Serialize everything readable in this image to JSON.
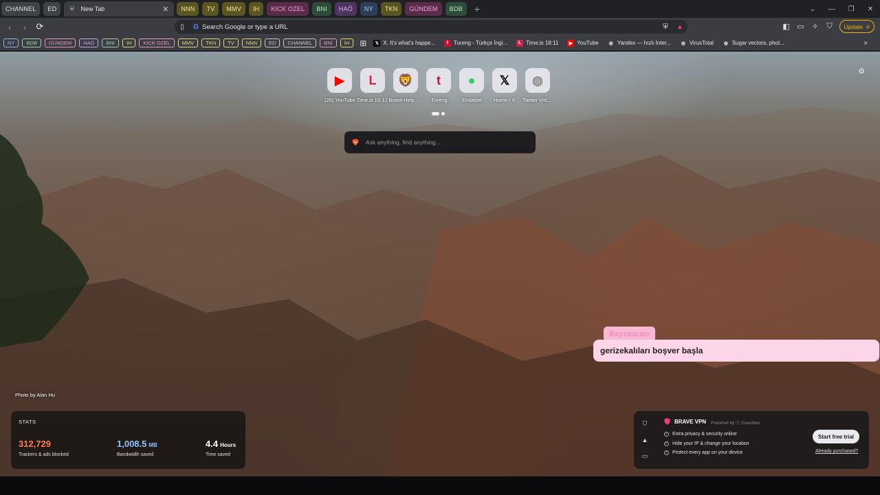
{
  "tab_groups_left": [
    {
      "label": "CHANNEL",
      "bg": "#3f4246",
      "fg": "#e4e4e4"
    },
    {
      "label": "ED",
      "bg": "#3f4246",
      "fg": "#e4e4e4"
    }
  ],
  "active_tab": {
    "title": "New Tab"
  },
  "tab_groups_right": [
    {
      "label": "NNN",
      "bg": "#5b5521",
      "fg": "#f5e9a3"
    },
    {
      "label": "TV",
      "bg": "#5b5521",
      "fg": "#f5e9a3"
    },
    {
      "label": "MMV",
      "bg": "#5b5521",
      "fg": "#f5e9a3"
    },
    {
      "label": "IH",
      "bg": "#5b5521",
      "fg": "#f5e9a3"
    },
    {
      "label": "KICK OZEL",
      "bg": "#5d2b4a",
      "fg": "#f1a6d6"
    },
    {
      "label": "BNI",
      "bg": "#2f4b3a",
      "fg": "#bfe7c9"
    },
    {
      "label": "HAÖ",
      "bg": "#4d3462",
      "fg": "#dcbcf6"
    },
    {
      "label": "NY",
      "bg": "#2b3e5a",
      "fg": "#b9d2f7"
    },
    {
      "label": "TKN",
      "bg": "#5b5521",
      "fg": "#f5e9a3"
    },
    {
      "label": "GÜNDEM",
      "bg": "#5d2b4a",
      "fg": "#f1a6d6"
    },
    {
      "label": "BDB",
      "bg": "#2f4b3a",
      "fg": "#bfe7c9"
    }
  ],
  "window_controls": {
    "list": "⌄",
    "minimize": "—",
    "restore": "❐",
    "close": "✕"
  },
  "toolbar": {
    "url_placeholder": "Search Google or type a URL",
    "update_label": "Update"
  },
  "bookmark_folders": [
    {
      "label": "NY",
      "color": "#8fb3ea"
    },
    {
      "label": "BDB",
      "color": "#9fd3a8"
    },
    {
      "label": "GÜNDEM",
      "color": "#e79ac8"
    },
    {
      "label": "HAÖ",
      "color": "#c8a4ee"
    },
    {
      "label": "BNI",
      "color": "#9fd3a8"
    },
    {
      "label": "IH",
      "color": "#e6d77a"
    },
    {
      "label": "KICK OZEL",
      "color": "#e79ac8"
    },
    {
      "label": "MMV",
      "color": "#e6d77a"
    },
    {
      "label": "TKN",
      "color": "#e6d77a"
    },
    {
      "label": "TV",
      "color": "#e6d77a"
    },
    {
      "label": "NNN",
      "color": "#e6d77a"
    },
    {
      "label": "ED",
      "color": "#c9c9c9"
    },
    {
      "label": "CHANNEL",
      "color": "#c9c9c9"
    },
    {
      "label": "BNİ",
      "color": "#e79ac8"
    },
    {
      "label": "İH",
      "color": "#e6d77a"
    }
  ],
  "bookmark_links": [
    {
      "label": "X. It's what's happe...",
      "icon": "x-icon",
      "glyph": "𝕏",
      "bg": "#000000",
      "fg": "#ffffff"
    },
    {
      "label": "Tureng - Türkçe İngi...",
      "icon": "tureng-icon",
      "glyph": "t",
      "bg": "#c8102e",
      "fg": "#ffffff"
    },
    {
      "label": "Time.is 18:11",
      "icon": "timeis-icon",
      "glyph": "L",
      "bg": "#d11f48",
      "fg": "#ffffff"
    },
    {
      "label": "YouTube",
      "icon": "youtube-icon",
      "glyph": "▶",
      "bg": "#ff0000",
      "fg": "#ffffff"
    },
    {
      "label": "Yandex — hızlı İnter...",
      "icon": "globe-icon",
      "glyph": "◍",
      "bg": "#3b3d42",
      "fg": "#dddddd"
    },
    {
      "label": "VirusTotal",
      "icon": "globe-icon",
      "glyph": "◍",
      "bg": "#3b3d42",
      "fg": "#dddddd"
    },
    {
      "label": "Sugar vectors, phot...",
      "icon": "globe-icon",
      "glyph": "◍",
      "bg": "#3b3d42",
      "fg": "#dddddd"
    }
  ],
  "top_sites": [
    {
      "name": "youtube-tile",
      "glyph": "▶",
      "color": "#ff0000"
    },
    {
      "name": "timeis-tile",
      "glyph": "L",
      "color": "#d11f48"
    },
    {
      "name": "brave-tile",
      "glyph": "🦁",
      "color": "#fb542b"
    },
    {
      "name": "tureng-tile",
      "glyph": "t",
      "color": "#c8102e"
    },
    {
      "name": "emlakjet-tile",
      "glyph": "●",
      "color": "#33cc66"
    },
    {
      "name": "x-tile",
      "glyph": "𝕏",
      "color": "#000000"
    },
    {
      "name": "twitter-video-tile",
      "glyph": "◍",
      "color": "#8a8a8a"
    }
  ],
  "top_site_labels": {
    "combined": "(26) YouTube Time.is 16:12 Brave Help...",
    "tureng": "Tureng",
    "emlakjet": "Emlakjet",
    "home_x": "Home / X",
    "twitter": "Twitter Vid..."
  },
  "search": {
    "placeholder": "Ask anything, find anything..."
  },
  "chat": {
    "name": "Beyzaucarr",
    "message": "gerizekalıları boşver başla"
  },
  "photo_credit": "Photo by Alan Hu",
  "stats": {
    "title": "STATS",
    "trackers": {
      "value": "312,729",
      "label": "Trackers & ads blocked",
      "color": "#ff7a52"
    },
    "bandwidth": {
      "value": "1,008.5",
      "unit": "MB",
      "label": "Bandwidth saved",
      "color": "#8fc4ff"
    },
    "time": {
      "value": "4.4",
      "unit": "Hours",
      "label": "Time saved",
      "color": "#ffffff"
    }
  },
  "vpn": {
    "title": "BRAVE VPN",
    "powered": "Powered by ⓥ Guardian",
    "features": [
      "Extra privacy & security online",
      "Hide your IP & change your location",
      "Protect every app on your device"
    ],
    "cta": "Start free trial",
    "already": "Already purchased?"
  }
}
